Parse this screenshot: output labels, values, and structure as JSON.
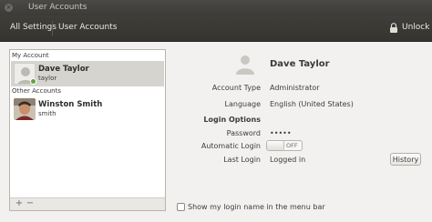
{
  "window": {
    "title": "User Accounts"
  },
  "toolbar": {
    "all_settings": "All Settings",
    "breadcrumb": "User Accounts",
    "unlock": "Unlock"
  },
  "accounts_list": {
    "my_account_header": "My Account",
    "other_accounts_header": "Other Accounts",
    "my_account": {
      "name": "Dave Taylor",
      "username": "taylor",
      "status": "online"
    },
    "others": [
      {
        "name": "Winston Smith",
        "username": "smith"
      }
    ],
    "add_label": "+",
    "remove_label": "−"
  },
  "details": {
    "full_name": "Dave Taylor",
    "account_type_label": "Account Type",
    "account_type_value": "Administrator",
    "language_label": "Language",
    "language_value": "English (United States)",
    "login_options_header": "Login Options",
    "password_label": "Password",
    "password_value": "•••••",
    "auto_login_label": "Automatic Login",
    "auto_login_state": "OFF",
    "last_login_label": "Last Login",
    "last_login_value": "Logged in",
    "history_button": "History"
  },
  "footer": {
    "show_login_name_label": "Show my login name in the menu bar"
  },
  "colors": {
    "toolbar_bg": "#3c3b37",
    "online": "#5fa43f",
    "selected_row": "#d6d4cf"
  }
}
